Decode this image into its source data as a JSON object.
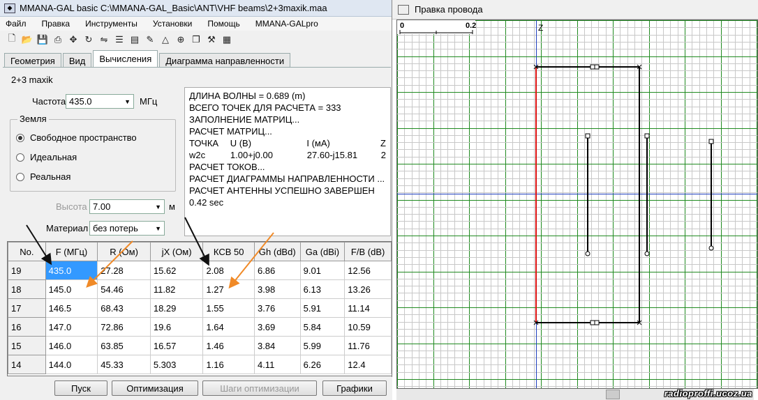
{
  "main_window": {
    "title": "MMANA-GAL basic C:\\MMANA-GAL_Basic\\ANT\\VHF beams\\2+3maxik.maa",
    "menu": [
      "Файл",
      "Правка",
      "Инструменты",
      "Установки",
      "Помощь",
      "MMANA-GALpro"
    ],
    "toolbar_icons": [
      "new-file-icon",
      "open-folder-icon",
      "save-icon",
      "print-icon",
      "move-icon",
      "rotate-icon",
      "mirror-icon",
      "wire-edit-icon",
      "document-icon",
      "view-icon",
      "triangle-icon",
      "target-icon",
      "copy-icon",
      "tools-icon",
      "calculator-icon"
    ],
    "tabs": [
      "Геометрия",
      "Вид",
      "Вычисления",
      "Диаграмма направленности"
    ],
    "active_tab": "Вычисления",
    "project_name": "2+3 maxik",
    "frequency": {
      "label": "Частота",
      "value": "435.0",
      "unit": "МГц"
    },
    "ground": {
      "title": "Земля",
      "options": [
        "Свободное пространство",
        "Идеальная",
        "Реальная"
      ],
      "selected": "Свободное пространство"
    },
    "height": {
      "label": "Высота",
      "value": "7.00",
      "unit": "м"
    },
    "material": {
      "label": "Материал",
      "value": "без потерь"
    },
    "log": {
      "lines": [
        "ДЛИНА ВОЛНЫ = 0.689 (m)",
        "ВСЕГО ТОЧЕК ДЛЯ РАСЧЕТА = 333",
        "ЗАПОЛНЕНИЕ МАТРИЦ...",
        "РАСЧЕТ МАТРИЦ..."
      ],
      "header": [
        "ТОЧКА",
        "U (В)",
        "I (мА)",
        "Z"
      ],
      "values": [
        "w2c",
        "1.00+j0.00",
        "27.60-j15.81",
        "2"
      ],
      "lines2": [
        "РАСЧЕТ ТОКОВ...",
        "РАСЧЕТ ДИАГРАММЫ НАПРАВЛЕННОСТИ ...",
        "РАСЧЕТ АНТЕННЫ УСПЕШНО ЗАВЕРШЕН",
        "0.42 sec"
      ]
    },
    "table": {
      "columns": [
        "No.",
        "F (МГц)",
        "R (Ом)",
        "jX (Ом)",
        "КСВ 50",
        "Gh (dBd)",
        "Ga (dBi)",
        "F/B (dB)"
      ],
      "rows": [
        [
          "19",
          "435.0",
          "27.28",
          "15.62",
          "2.08",
          "6.86",
          "9.01",
          "12.56"
        ],
        [
          "18",
          "145.0",
          "54.46",
          "11.82",
          "1.27",
          "3.98",
          "6.13",
          "13.26"
        ],
        [
          "17",
          "146.5",
          "68.43",
          "18.29",
          "1.55",
          "3.76",
          "5.91",
          "11.14"
        ],
        [
          "16",
          "147.0",
          "72.86",
          "19.6",
          "1.64",
          "3.69",
          "5.84",
          "10.59"
        ],
        [
          "15",
          "146.0",
          "63.85",
          "16.57",
          "1.46",
          "3.84",
          "5.99",
          "11.76"
        ],
        [
          "14",
          "144.0",
          "45.33",
          "5.303",
          "1.16",
          "4.11",
          "6.26",
          "12.4"
        ]
      ]
    },
    "buttons": [
      "Пуск",
      "Оптимизация",
      "Шаги оптимизации",
      "Графики"
    ]
  },
  "wire_window": {
    "title": "Правка провода",
    "scale_left": "0",
    "scale_right": "0.2",
    "axis_label": "Z",
    "colors": {
      "grid_minor": "#c8c8c8",
      "grid_major": "#1f8a1f",
      "axis": "#1f3fbf",
      "wire": "#000000",
      "selected_wire": "#dd1111"
    }
  },
  "watermark": "radioproffi.ucoz.ua"
}
